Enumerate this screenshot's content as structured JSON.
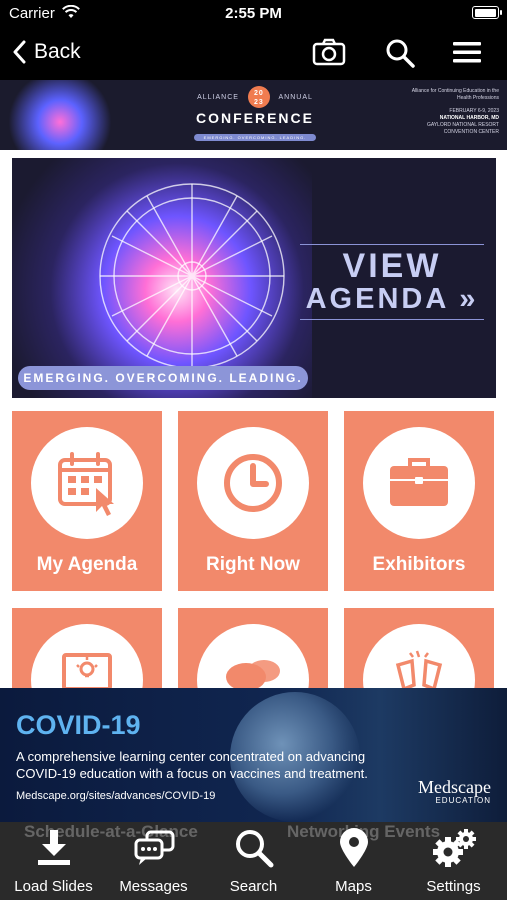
{
  "status_bar": {
    "carrier": "Carrier",
    "time": "2:55 PM",
    "battery_level": 1.0
  },
  "nav": {
    "back_label": "Back",
    "icons": [
      "camera-icon",
      "search-icon",
      "menu-icon"
    ]
  },
  "header_banner": {
    "left_word": "ALLIANCE",
    "year": "20 23",
    "right_word": "ANNUAL",
    "title": "CONFERENCE",
    "tagline": "EMERGING. OVERCOMING. LEADING.",
    "org_line": "Alliance for Continuing Education in the Health Professions",
    "dates": "FEBRUARY 6-9, 2023",
    "location": "NATIONAL HARBOR, MD",
    "venue": "GAYLORD NATIONAL RESORT CONVENTION CENTER"
  },
  "agenda_banner": {
    "line1": "VIEW",
    "line2": "AGENDA »",
    "tagline": "EMERGING. OVERCOMING. LEADING."
  },
  "tiles": [
    {
      "label": "My Agenda",
      "icon": "calendar-icon"
    },
    {
      "label": "Right Now",
      "icon": "clock-icon"
    },
    {
      "label": "Exhibitors",
      "icon": "briefcase-icon"
    },
    {
      "label": "Schedule-at-a-Glance",
      "icon": "presentation-icon"
    },
    {
      "label": "Networking Events",
      "icon": "chat-bubbles-icon"
    },
    {
      "label": "",
      "icon": "toast-glasses-icon"
    }
  ],
  "ad": {
    "title": "COVID-19",
    "description": "A comprehensive learning center concentrated on advancing COVID-19 education with a focus on vaccines and treatment.",
    "url": "Medscape.org/sites/advances/COVID-19",
    "brand": "Medscape",
    "brand_sub": "EDUCATION"
  },
  "tab_bar": {
    "ghost_left": "Schedule-at-a-Glance",
    "ghost_right": "Networking Events",
    "tabs": [
      {
        "label": "Load Slides",
        "icon": "download-icon"
      },
      {
        "label": "Messages",
        "icon": "messages-icon"
      },
      {
        "label": "Search",
        "icon": "search-icon"
      },
      {
        "label": "Maps",
        "icon": "map-pin-icon"
      },
      {
        "label": "Settings",
        "icon": "gear-icon"
      }
    ]
  },
  "colors": {
    "tile": "#f2896b",
    "navbar": "#000000",
    "tabbar": "#2a2a2a",
    "banner": "#1b1a30",
    "accent_blue": "#5fb3f0"
  }
}
